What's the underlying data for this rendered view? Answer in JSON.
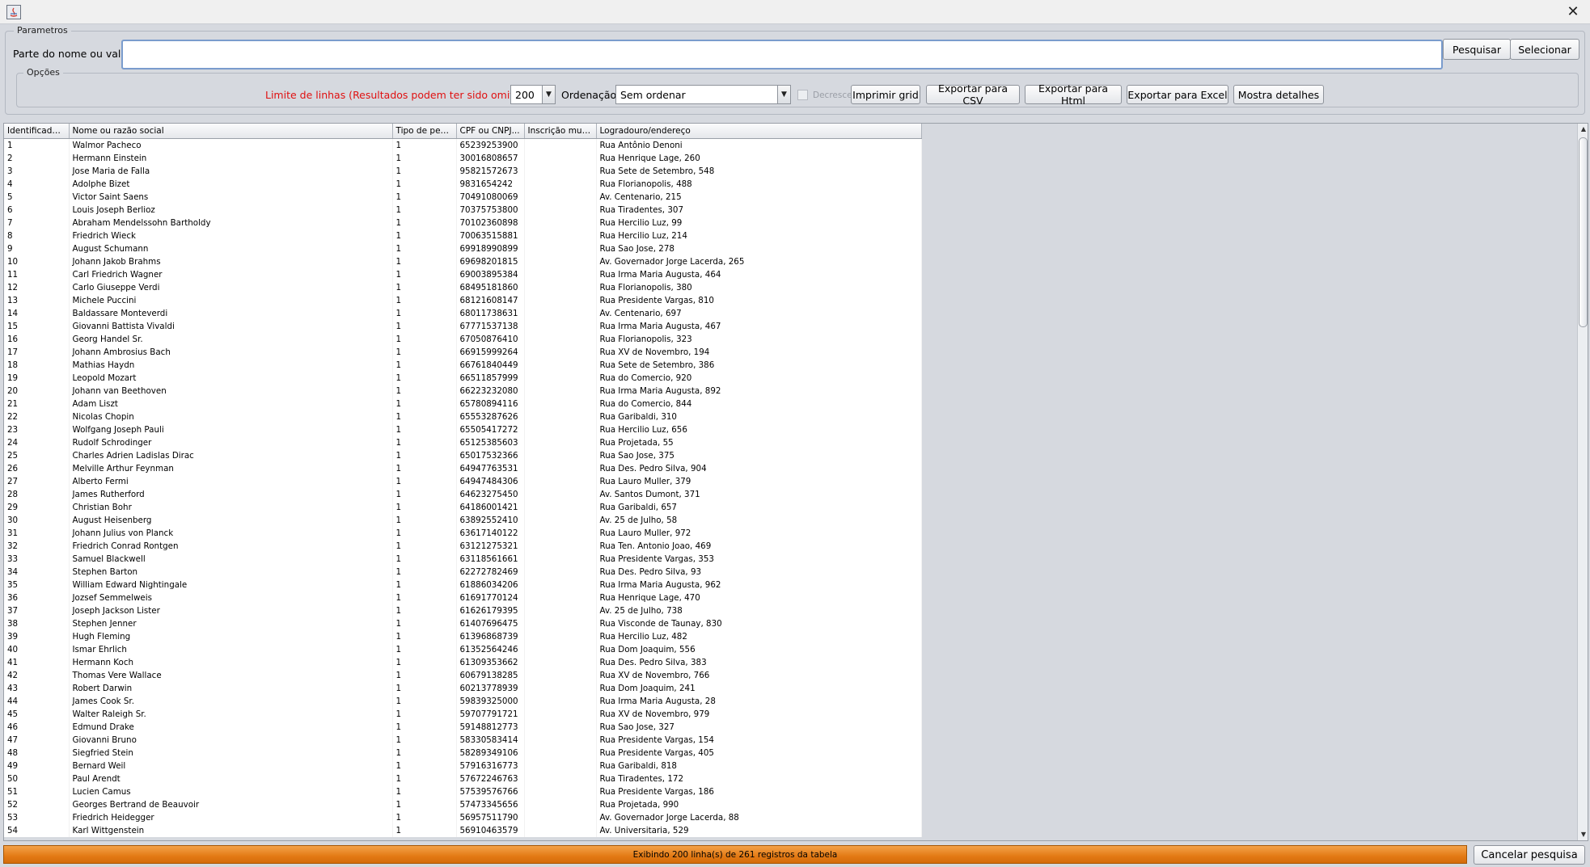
{
  "window": {
    "close_glyph": "✕"
  },
  "params": {
    "group_title": "Parametros",
    "search_label": "Parte do nome ou valor:",
    "search_value": "",
    "search_button": "Pesquisar",
    "select_button": "Selecionar"
  },
  "options": {
    "group_title": "Opções",
    "limit_label": "Limite de linhas (Resultados podem ter sido omitidos)",
    "limit_value": "200",
    "ordenacao_label": "Ordenação",
    "ordenacao_value": "Sem ordenar",
    "decrescente_label": "Decrescente",
    "decrescente_checked": false,
    "imprimir_label": "Imprimir grid",
    "csv_label": "Exportar para CSV",
    "html_label": "Exportar para Html",
    "excel_label": "Exportar para Excel",
    "detalhes_label": "Mostra detalhes"
  },
  "table": {
    "columns": [
      "Identificador...",
      "Nome ou razão social",
      "Tipo de pess...",
      "CPF ou CNPJ...",
      "Inscrição muni...",
      "Logradouro/endereço"
    ],
    "rows": [
      [
        "1",
        "Walmor Pacheco",
        "1",
        "65239253900",
        "",
        "Rua Antônio Denoni"
      ],
      [
        "2",
        "Hermann Einstein",
        "1",
        "30016808657",
        "",
        "Rua Henrique Lage, 260"
      ],
      [
        "3",
        "Jose Maria de Falla",
        "1",
        "95821572673",
        "",
        "Rua Sete de Setembro, 548"
      ],
      [
        "4",
        "Adolphe Bizet",
        "1",
        "9831654242",
        "",
        "Rua Florianopolis, 488"
      ],
      [
        "5",
        "Victor Saint Saens",
        "1",
        "70491080069",
        "",
        "Av. Centenario, 215"
      ],
      [
        "6",
        "Louis Joseph Berlioz",
        "1",
        "70375753800",
        "",
        "Rua Tiradentes, 307"
      ],
      [
        "7",
        "Abraham Mendelssohn Bartholdy",
        "1",
        "70102360898",
        "",
        "Rua Hercilio Luz, 99"
      ],
      [
        "8",
        "Friedrich Wieck",
        "1",
        "70063515881",
        "",
        "Rua Hercilio Luz, 214"
      ],
      [
        "9",
        "August Schumann",
        "1",
        "69918990899",
        "",
        "Rua Sao Jose, 278"
      ],
      [
        "10",
        "Johann Jakob Brahms",
        "1",
        "69698201815",
        "",
        "Av. Governador Jorge Lacerda, 265"
      ],
      [
        "11",
        "Carl Friedrich Wagner",
        "1",
        "69003895384",
        "",
        "Rua Irma Maria Augusta, 464"
      ],
      [
        "12",
        "Carlo Giuseppe Verdi",
        "1",
        "68495181860",
        "",
        "Rua Florianopolis, 380"
      ],
      [
        "13",
        "Michele Puccini",
        "1",
        "68121608147",
        "",
        "Rua Presidente Vargas, 810"
      ],
      [
        "14",
        "Baldassare Monteverdi",
        "1",
        "68011738631",
        "",
        "Av. Centenario, 697"
      ],
      [
        "15",
        "Giovanni Battista Vivaldi",
        "1",
        "67771537138",
        "",
        "Rua Irma Maria Augusta, 467"
      ],
      [
        "16",
        "Georg Handel Sr.",
        "1",
        "67050876410",
        "",
        "Rua Florianopolis, 323"
      ],
      [
        "17",
        "Johann Ambrosius Bach",
        "1",
        "66915999264",
        "",
        "Rua XV de Novembro, 194"
      ],
      [
        "18",
        "Mathias Haydn",
        "1",
        "66761840449",
        "",
        "Rua Sete de Setembro, 386"
      ],
      [
        "19",
        "Leopold Mozart",
        "1",
        "66511857999",
        "",
        "Rua do Comercio, 920"
      ],
      [
        "20",
        "Johann van Beethoven",
        "1",
        "66223232080",
        "",
        "Rua Irma Maria Augusta, 892"
      ],
      [
        "21",
        "Adam Liszt",
        "1",
        "65780894116",
        "",
        "Rua do Comercio, 844"
      ],
      [
        "22",
        "Nicolas Chopin",
        "1",
        "65553287626",
        "",
        "Rua Garibaldi, 310"
      ],
      [
        "23",
        "Wolfgang Joseph Pauli",
        "1",
        "65505417272",
        "",
        "Rua Hercilio Luz, 656"
      ],
      [
        "24",
        "Rudolf Schrodinger",
        "1",
        "65125385603",
        "",
        "Rua Projetada, 55"
      ],
      [
        "25",
        "Charles Adrien Ladislas Dirac",
        "1",
        "65017532366",
        "",
        "Rua Sao Jose, 375"
      ],
      [
        "26",
        "Melville Arthur Feynman",
        "1",
        "64947763531",
        "",
        "Rua Des. Pedro Silva, 904"
      ],
      [
        "27",
        "Alberto Fermi",
        "1",
        "64947484306",
        "",
        "Rua Lauro Muller, 379"
      ],
      [
        "28",
        "James Rutherford",
        "1",
        "64623275450",
        "",
        "Av. Santos Dumont, 371"
      ],
      [
        "29",
        "Christian Bohr",
        "1",
        "64186001421",
        "",
        "Rua Garibaldi, 657"
      ],
      [
        "30",
        "August Heisenberg",
        "1",
        "63892552410",
        "",
        "Av. 25 de Julho, 58"
      ],
      [
        "31",
        "Johann Julius von Planck",
        "1",
        "63617140122",
        "",
        "Rua Lauro Muller, 972"
      ],
      [
        "32",
        "Friedrich Conrad Rontgen",
        "1",
        "63121275321",
        "",
        "Rua Ten. Antonio Joao, 469"
      ],
      [
        "33",
        "Samuel Blackwell",
        "1",
        "63118561661",
        "",
        "Rua Presidente Vargas, 353"
      ],
      [
        "34",
        "Stephen Barton",
        "1",
        "62272782469",
        "",
        "Rua Des. Pedro Silva, 93"
      ],
      [
        "35",
        "William Edward Nightingale",
        "1",
        "61886034206",
        "",
        "Rua Irma Maria Augusta, 962"
      ],
      [
        "36",
        "Jozsef Semmelweis",
        "1",
        "61691770124",
        "",
        "Rua Henrique Lage, 470"
      ],
      [
        "37",
        "Joseph Jackson Lister",
        "1",
        "61626179395",
        "",
        "Av. 25 de Julho, 738"
      ],
      [
        "38",
        "Stephen Jenner",
        "1",
        "61407696475",
        "",
        "Rua Visconde de Taunay, 830"
      ],
      [
        "39",
        "Hugh Fleming",
        "1",
        "61396868739",
        "",
        "Rua Hercilio Luz, 482"
      ],
      [
        "40",
        "Ismar Ehrlich",
        "1",
        "61352564246",
        "",
        "Rua Dom Joaquim, 556"
      ],
      [
        "41",
        "Hermann Koch",
        "1",
        "61309353662",
        "",
        "Rua Des. Pedro Silva, 383"
      ],
      [
        "42",
        "Thomas Vere Wallace",
        "1",
        "60679138285",
        "",
        "Rua XV de Novembro, 766"
      ],
      [
        "43",
        "Robert Darwin",
        "1",
        "60213778939",
        "",
        "Rua Dom Joaquim, 241"
      ],
      [
        "44",
        "James Cook Sr.",
        "1",
        "59839325000",
        "",
        "Rua Irma Maria Augusta, 28"
      ],
      [
        "45",
        "Walter Raleigh Sr.",
        "1",
        "59707791721",
        "",
        "Rua XV de Novembro, 979"
      ],
      [
        "46",
        "Edmund Drake",
        "1",
        "59148812773",
        "",
        "Rua Sao Jose, 327"
      ],
      [
        "47",
        "Giovanni Bruno",
        "1",
        "58330583414",
        "",
        "Rua Presidente Vargas, 154"
      ],
      [
        "48",
        "Siegfried Stein",
        "1",
        "58289349106",
        "",
        "Rua Presidente Vargas, 405"
      ],
      [
        "49",
        "Bernard Weil",
        "1",
        "57916316773",
        "",
        "Rua Garibaldi, 818"
      ],
      [
        "50",
        "Paul Arendt",
        "1",
        "57672246763",
        "",
        "Rua Tiradentes, 172"
      ],
      [
        "51",
        "Lucien Camus",
        "1",
        "57539576766",
        "",
        "Rua Presidente Vargas, 186"
      ],
      [
        "52",
        "Georges Bertrand de Beauvoir",
        "1",
        "57473345656",
        "",
        "Rua Projetada, 990"
      ],
      [
        "53",
        "Friedrich Heidegger",
        "1",
        "56957511790",
        "",
        "Av. Governador Jorge Lacerda, 88"
      ],
      [
        "54",
        "Karl Wittgenstein",
        "1",
        "56910463579",
        "",
        "Av. Universitaria, 529"
      ]
    ]
  },
  "status": {
    "text": "Exibindo 200 linha(s) de 261 registros da tabela",
    "cancel_label": "Cancelar pesquisa"
  }
}
